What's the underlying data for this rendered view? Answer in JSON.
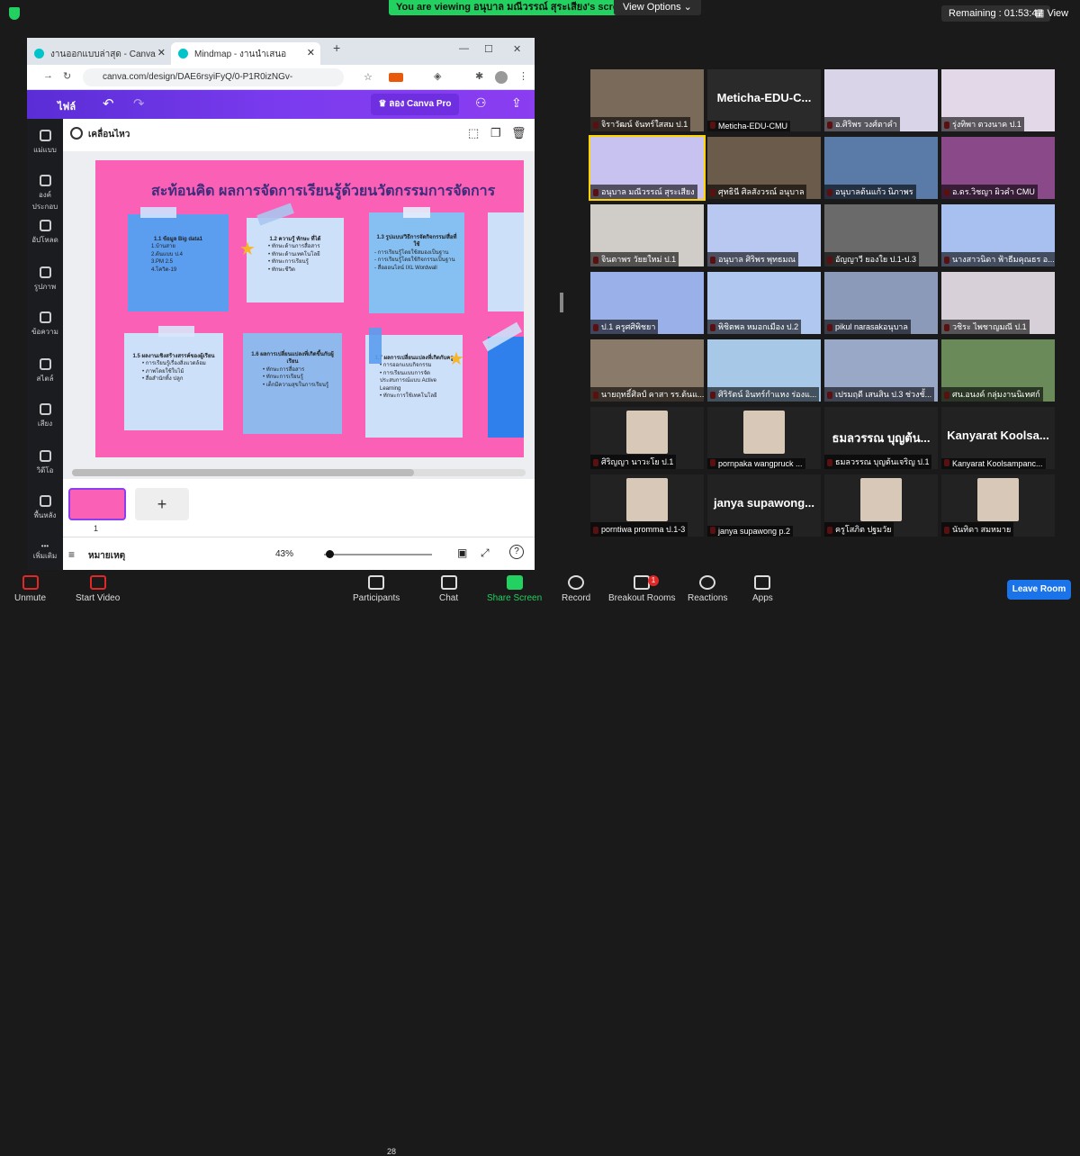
{
  "zoom": {
    "banner": "You are viewing อนุบาล มณีวรรณ์ สุระเสียง's screen",
    "view_options": "View Options ⌄",
    "remaining": "Remaining : 01:53:47",
    "view": "View",
    "toolbar": {
      "unmute": "Unmute",
      "start_video": "Start Video",
      "participants": "Participants",
      "participant_count": "28",
      "chat": "Chat",
      "share_screen": "Share Screen",
      "record": "Record",
      "breakout": "Breakout Rooms",
      "breakout_badge": "1",
      "reactions": "Reactions",
      "apps": "Apps",
      "leave": "Leave Room"
    }
  },
  "browser": {
    "tabs": [
      {
        "label": "งานออกแบบล่าสุด - Canva"
      },
      {
        "label": "Mindmap - งานนำเสนอ"
      }
    ],
    "url": "canva.com/design/DAE6rsyiFyQ/0-P1R0izNGv-tWAWrPU5..."
  },
  "canva": {
    "file": "ไฟล์",
    "pro": "♛ ลอง Canva Pro",
    "sidebar": [
      "แม่แบบ",
      "องค์ประกอบ",
      "อัปโหลด",
      "รูปภาพ",
      "ข้อความ",
      "สไตล์",
      "เสียง",
      "วิดีโอ",
      "พื้นหลัง",
      "เพิ่มเติม"
    ],
    "animate": "เคลื่อนไหว",
    "slide_title": "สะท้อนคิด ผลการจัดการเรียนรู้ด้วยนวัตกรรมการจัดการ",
    "notes": [
      {
        "h": "1.1 ข้อมูล Big data1",
        "b": "1.บ้านสาย\n2.ต้นแบบ ป.4\n3.PM 2.5\n4.โควิด-19"
      },
      {
        "h": "1.2 ความรู้ ทักษะ ที่ได้",
        "b": "• ทักษะด้านการสื่อสาร\n• ทักษะด้านเทคโนโลยี\n• ทักษะการเรียนรู้\n• ทักษะชีวิต"
      },
      {
        "h": "1.3 รูปแบบ/วิธีการจัดกิจกรรม/สื่อที่ใช้",
        "b": "- การเรียนรู้โดยใช้สมองเป็นฐาน\n- การเรียนรู้โดยใช้กิจกรรมเป็นฐาน\n- สื่อออนไลน์ IXL Wordwall"
      },
      {
        "h": "1.5 ผลงานเชิงสร้างสรรค์ของผู้เรียน",
        "b": "• การเรียนรู้เรื่องสิ่งแวดล้อม\n• ภาพโดยใช้ใบไม้\n• สื่อสำนักทิ้ง ปลูก"
      },
      {
        "h": "1.6 ผลการเปลี่ยนแปลงที่เกิดขึ้นกับผู้เรียน",
        "b": "• ทักษะการสื่อสาร\n• ทักษะการเรียนรู้\n• เด็กมีความสุขในการเรียนรู้"
      },
      {
        "h": "1.7 ผลการเปลี่ยนแปลงที่เกิดกับครู",
        "b": "• การออกแบบกิจกรรม\n• การเรียนแบบการจัดประสบการณ์แบบ Active Learning\n• ทักษะการใช้เทคโนโลยี"
      }
    ],
    "page_number": "1",
    "add_page": "+",
    "notes_label": "หมายเหตุ",
    "zoom_pct": "43%"
  },
  "participants": [
    "จิราวัฒน์ จันทร์ใสสม ป.1",
    "Meticha-EDU-CMU",
    "อ.ศิริพร วงศ์ตาคำ",
    "รุ่งทิพา ตวงนาค ป.1",
    "อนุบาล มณีวรรณ์ สุระเสียง",
    "ศุทธินี ศิลสังวรณ์ อนุบาล",
    "อนุบาลต้นแก้ว นิภาพร",
    "อ.ดร.วิชญา ผิวคำ CMU",
    "จินตาพร วัยยใหม่ ป.1",
    "อนุบาล ศิริพร พุทธมณ",
    "อัญญาวี ยองใย ป.1-ป.3",
    "นางสาวนิดา ฟ้าธีมคุณธร อ...",
    "ป.1 ครูศศิพิชยา",
    "พิชิตพล หมอกเมือง ป.2",
    "pikul narasakอนุบาล",
    "วชิระ ไพชาญมณี ป.1",
    "นายฤทธิ์ศิลป์ คาสา รร.ต้นแ...",
    "ศิริรัตน์ อินทร์กำแหง ร่องแ...",
    "เปรมฤดี เสนสิน ป.3 ช่วงชั้...",
    "ศน.อนงค์ กลุ่มงานนิเทศก์",
    "ศิริญญา นาวะโย ป.1",
    "pornpaka wangpruck ...",
    "ธมลวรรณ บุญต้นเจริญ ป.1",
    "Kanyarat Koolsampanc...",
    "porntiwa promma ป.1-3",
    "janya supawong p.2",
    "ครูโสภิต ปฐมวัย",
    "นันทิดา สมหมาย"
  ],
  "big_names": {
    "1": "Meticha-EDU-C...",
    "22": "ธมลวรรณ บุญต้น...",
    "23": "Kanyarat Koolsa...",
    "25": "janya supawong..."
  },
  "colors": {
    "green": "#23d160",
    "canva_purple": "#7a3bee",
    "slide_pink": "#fb60b7",
    "note_blue": "#5b9dee",
    "leave_blue": "#1a73e8"
  }
}
